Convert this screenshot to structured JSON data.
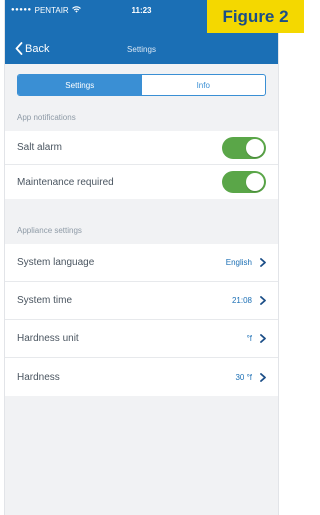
{
  "status_bar": {
    "signal_dots": "●●●●●",
    "carrier": "PENTAIR",
    "wifi_icon": "wifi-icon",
    "time": "11:23"
  },
  "nav": {
    "back_label": "Back",
    "title": "Settings"
  },
  "tabs": {
    "settings": "Settings",
    "info": "Info",
    "selected": "Settings"
  },
  "app_notifications": {
    "header": "App notifications",
    "items": [
      {
        "label": "Salt alarm",
        "enabled": true
      },
      {
        "label": "Maintenance required",
        "enabled": true
      }
    ]
  },
  "appliance_settings": {
    "header": "Appliance settings",
    "items": [
      {
        "label": "System language",
        "value": "English"
      },
      {
        "label": "System time",
        "value": "21:08"
      },
      {
        "label": "Hardness unit",
        "value": "°f"
      },
      {
        "label": "Hardness",
        "value": "30 °f"
      }
    ]
  },
  "badge": {
    "text": "Figure 2"
  },
  "colors": {
    "nav_blue": "#1b6fb5",
    "accent": "#3a8fd4",
    "toggle_on": "#5aa648",
    "badge_yellow": "#f4d800"
  }
}
